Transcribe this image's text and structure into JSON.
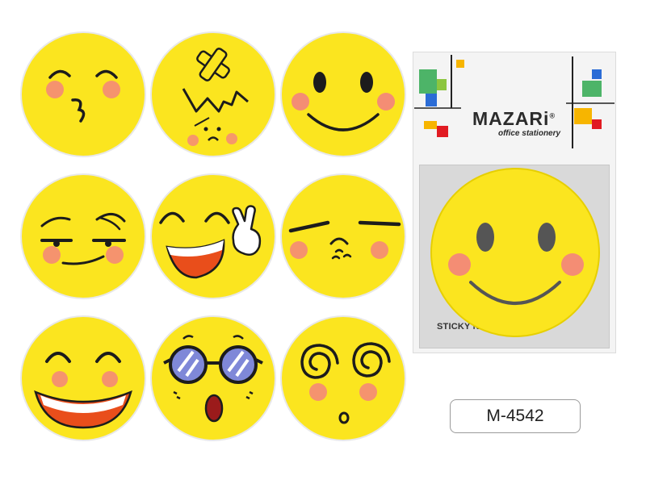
{
  "product": {
    "code": "M-4542",
    "stickers": [
      {
        "face": "kissing"
      },
      {
        "face": "bandaged"
      },
      {
        "face": "smiling"
      },
      {
        "face": "smirking"
      },
      {
        "face": "peace-sign"
      },
      {
        "face": "squinting"
      },
      {
        "face": "laughing"
      },
      {
        "face": "sunglasses-shocked"
      },
      {
        "face": "dizzy"
      }
    ]
  },
  "package": {
    "brand": "MAZARi",
    "registered_mark": "®",
    "tagline": "office stationery",
    "label": "STICKY NOTES"
  },
  "colors": {
    "face_yellow": "#fbe51f",
    "face_edge": "#d9c200",
    "blush": "#f3778a",
    "outline": "#1c1c1c"
  }
}
